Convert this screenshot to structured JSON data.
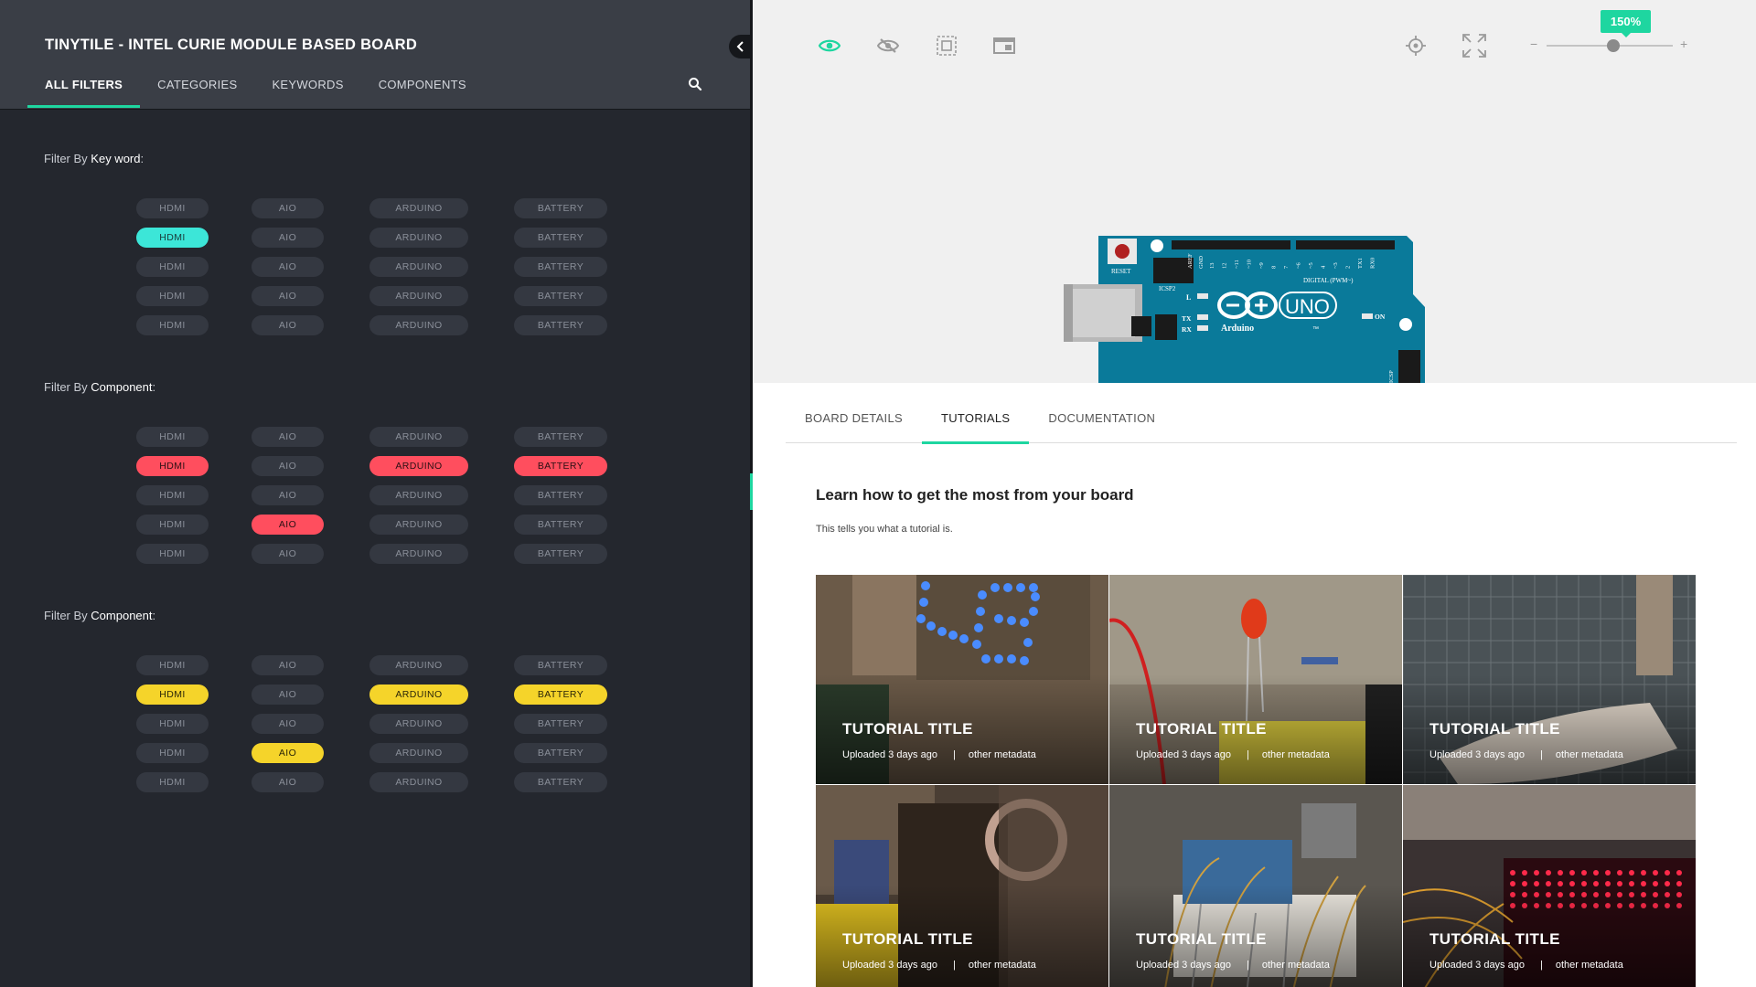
{
  "left_panel": {
    "title": "TINYTILE - INTEL CURIE MODULE BASED BOARD",
    "tabs": [
      "ALL FILTERS",
      "CATEGORIES",
      "KEYWORDS",
      "COMPONENTS"
    ],
    "active_tab": "ALL FILTERS",
    "filter_groups": [
      {
        "label_prefix": "Filter By ",
        "label_strong": "Key word",
        "label_suffix": ":",
        "accent": "#3ce6d8",
        "rows": [
          [
            {
              "label": "HDMI",
              "on": false
            },
            {
              "label": "AIO",
              "on": false
            },
            {
              "label": "ARDUINO",
              "on": false
            },
            {
              "label": "BATTERY",
              "on": false
            }
          ],
          [
            {
              "label": "HDMI",
              "on": true
            },
            {
              "label": "AIO",
              "on": false
            },
            {
              "label": "ARDUINO",
              "on": false
            },
            {
              "label": "BATTERY",
              "on": false
            }
          ],
          [
            {
              "label": "HDMI",
              "on": false
            },
            {
              "label": "AIO",
              "on": false
            },
            {
              "label": "ARDUINO",
              "on": false
            },
            {
              "label": "BATTERY",
              "on": false
            }
          ],
          [
            {
              "label": "HDMI",
              "on": false
            },
            {
              "label": "AIO",
              "on": false
            },
            {
              "label": "ARDUINO",
              "on": false
            },
            {
              "label": "BATTERY",
              "on": false
            }
          ],
          [
            {
              "label": "HDMI",
              "on": false
            },
            {
              "label": "AIO",
              "on": false
            },
            {
              "label": "ARDUINO",
              "on": false
            },
            {
              "label": "BATTERY",
              "on": false
            }
          ]
        ]
      },
      {
        "label_prefix": "Filter By ",
        "label_strong": "Component",
        "label_suffix": ":",
        "accent": "#ff4e5e",
        "rows": [
          [
            {
              "label": "HDMI",
              "on": false
            },
            {
              "label": "AIO",
              "on": false
            },
            {
              "label": "ARDUINO",
              "on": false
            },
            {
              "label": "BATTERY",
              "on": false
            }
          ],
          [
            {
              "label": "HDMI",
              "on": true
            },
            {
              "label": "AIO",
              "on": false
            },
            {
              "label": "ARDUINO",
              "on": true
            },
            {
              "label": "BATTERY",
              "on": true
            }
          ],
          [
            {
              "label": "HDMI",
              "on": false
            },
            {
              "label": "AIO",
              "on": false
            },
            {
              "label": "ARDUINO",
              "on": false
            },
            {
              "label": "BATTERY",
              "on": false
            }
          ],
          [
            {
              "label": "HDMI",
              "on": false
            },
            {
              "label": "AIO",
              "on": true
            },
            {
              "label": "ARDUINO",
              "on": false
            },
            {
              "label": "BATTERY",
              "on": false
            }
          ],
          [
            {
              "label": "HDMI",
              "on": false
            },
            {
              "label": "AIO",
              "on": false
            },
            {
              "label": "ARDUINO",
              "on": false
            },
            {
              "label": "BATTERY",
              "on": false
            }
          ]
        ]
      },
      {
        "label_prefix": "Filter By ",
        "label_strong": "Component",
        "label_suffix": ":",
        "accent": "#f5d42a",
        "rows": [
          [
            {
              "label": "HDMI",
              "on": false
            },
            {
              "label": "AIO",
              "on": false
            },
            {
              "label": "ARDUINO",
              "on": false
            },
            {
              "label": "BATTERY",
              "on": false
            }
          ],
          [
            {
              "label": "HDMI",
              "on": true
            },
            {
              "label": "AIO",
              "on": false
            },
            {
              "label": "ARDUINO",
              "on": true
            },
            {
              "label": "BATTERY",
              "on": true
            }
          ],
          [
            {
              "label": "HDMI",
              "on": false
            },
            {
              "label": "AIO",
              "on": false
            },
            {
              "label": "ARDUINO",
              "on": false
            },
            {
              "label": "BATTERY",
              "on": false
            }
          ],
          [
            {
              "label": "HDMI",
              "on": false
            },
            {
              "label": "AIO",
              "on": true
            },
            {
              "label": "ARDUINO",
              "on": false
            },
            {
              "label": "BATTERY",
              "on": false
            }
          ],
          [
            {
              "label": "HDMI",
              "on": false
            },
            {
              "label": "AIO",
              "on": false
            },
            {
              "label": "ARDUINO",
              "on": false
            },
            {
              "label": "BATTERY",
              "on": false
            }
          ]
        ]
      }
    ]
  },
  "toolbar": {
    "tools": [
      "eye-icon",
      "eye-off-icon",
      "select-frame-icon",
      "window-icon"
    ],
    "right_tools": [
      "crosshair-icon",
      "fullscreen-icon"
    ],
    "zoom_label": "150%",
    "zoom_minus": "−",
    "zoom_plus": "+",
    "zoom_fraction": 0.53
  },
  "board": {
    "reset_label": "RESET",
    "icsp2_label": "ICSP2",
    "digital_label": "DIGITAL (PWM~)",
    "aref_label": "AREF",
    "gnd_label": "GND",
    "l_label": "L",
    "tx_label": "TX",
    "rx_label": "RX",
    "on_label": "ON",
    "icsp_label": "ICSP",
    "brand": "Arduino",
    "model": "UNO",
    "tm": "™",
    "pin_labels": [
      "13",
      "12",
      "~11",
      "~10",
      "~9",
      "8",
      "7",
      "~6",
      "~5",
      "4",
      "~3",
      "2",
      "TX1",
      "RX0"
    ]
  },
  "content": {
    "tabs": [
      "BOARD DETAILS",
      "TUTORIALS",
      "DOCUMENTATION"
    ],
    "active_tab": "TUTORIALS",
    "section_title": "Learn how to get the most from your board",
    "section_desc": "This tells you what a tutorial is.",
    "tutorials": [
      {
        "title": "TUTORIAL TITLE",
        "uploaded": "Uploaded 3 days ago",
        "sep": "|",
        "meta": "other metadata",
        "scene": "led-matrix"
      },
      {
        "title": "TUTORIAL TITLE",
        "uploaded": "Uploaded 3 days ago",
        "sep": "|",
        "meta": "other metadata",
        "scene": "red-led"
      },
      {
        "title": "TUTORIAL TITLE",
        "uploaded": "Uploaded 3 days ago",
        "sep": "|",
        "meta": "other metadata",
        "scene": "drill"
      },
      {
        "title": "TUTORIAL TITLE",
        "uploaded": "Uploaded 3 days ago",
        "sep": "|",
        "meta": "other metadata",
        "scene": "desk"
      },
      {
        "title": "TUTORIAL TITLE",
        "uploaded": "Uploaded 3 days ago",
        "sep": "|",
        "meta": "other metadata",
        "scene": "breadboard"
      },
      {
        "title": "TUTORIAL TITLE",
        "uploaded": "Uploaded 3 days ago",
        "sep": "|",
        "meta": "other metadata",
        "scene": "led-sign"
      }
    ]
  },
  "colors": {
    "accent": "#1ed6a0",
    "left_bg": "#24272e",
    "header_bg": "#3a3e46",
    "board_blue": "#0a7a9a"
  }
}
